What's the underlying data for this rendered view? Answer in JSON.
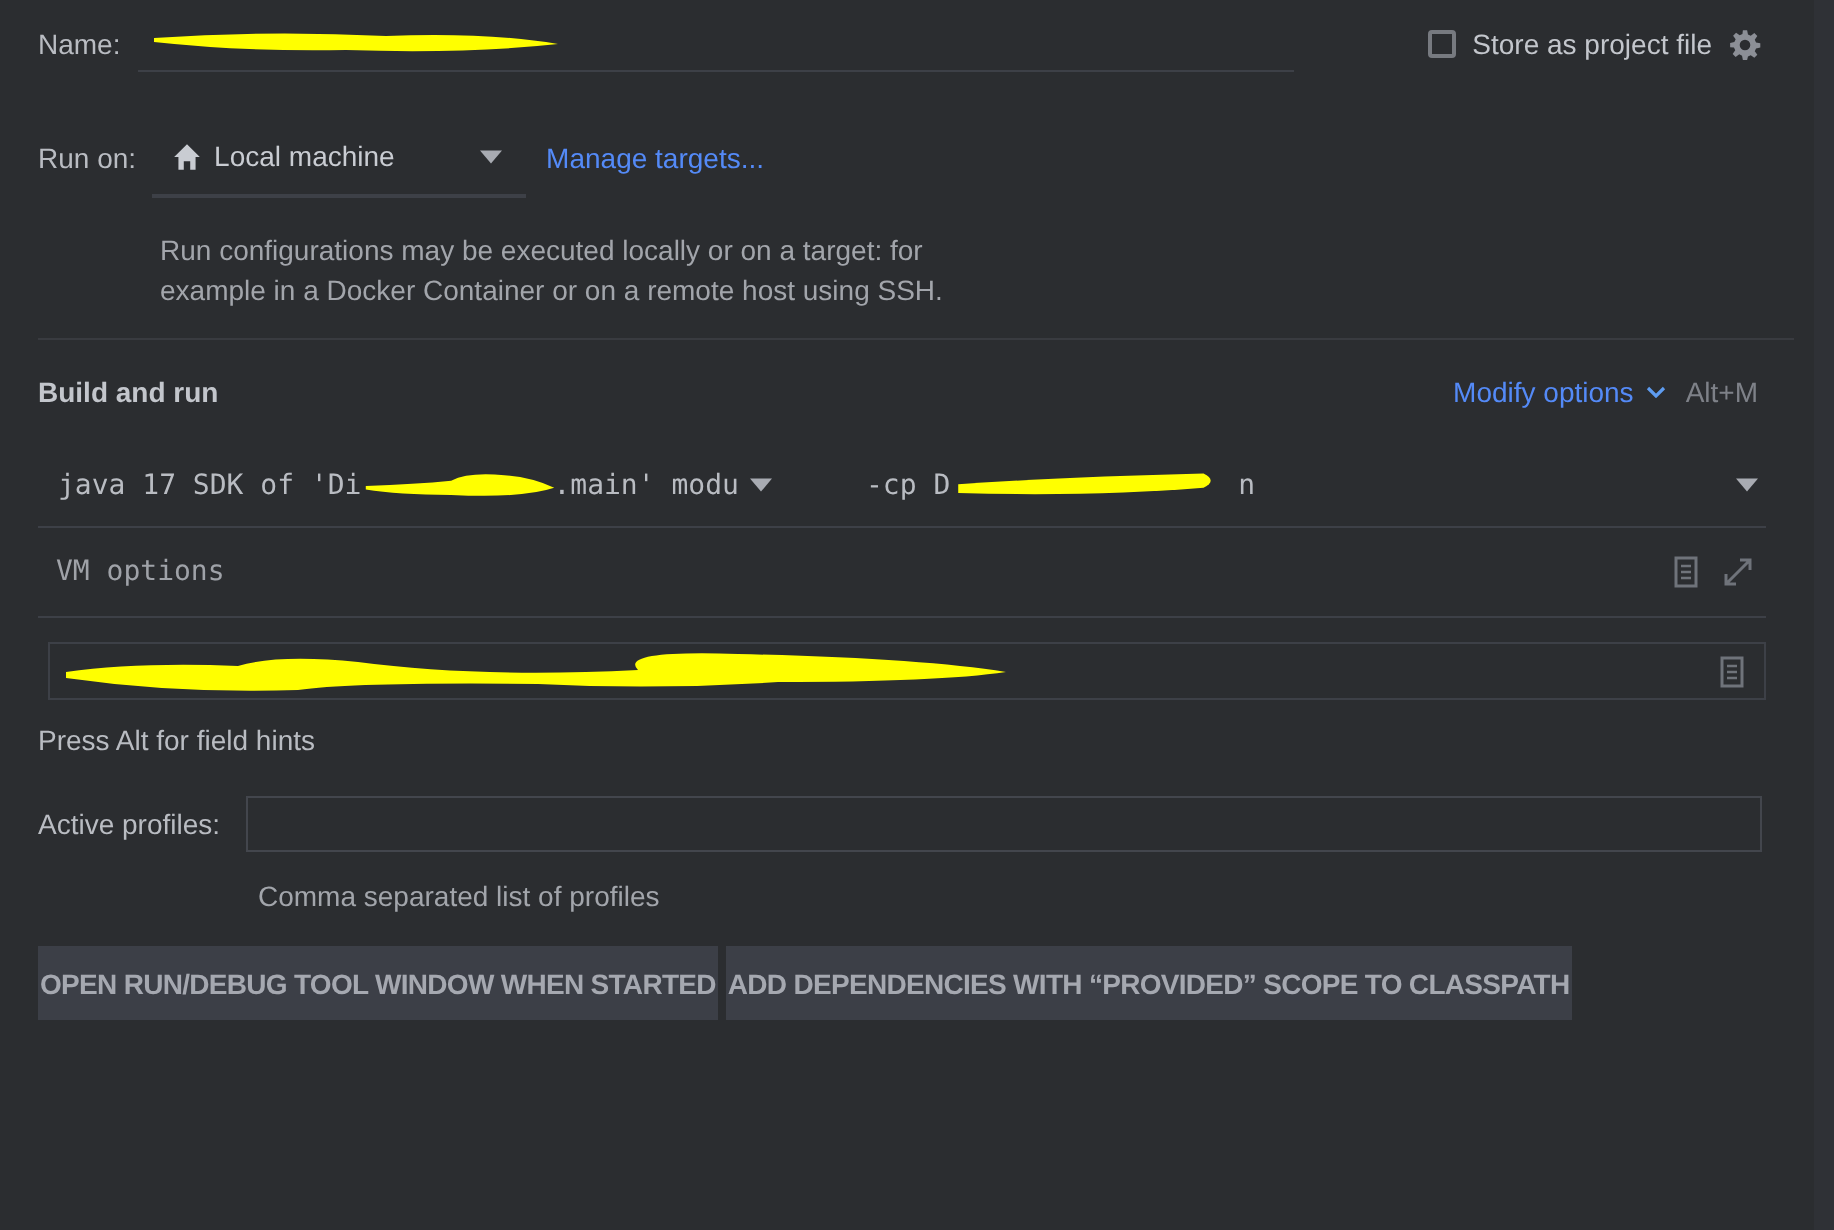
{
  "name_row": {
    "label": "Name:",
    "redacted": true,
    "store_checkbox": {
      "label": "Store as project file",
      "checked": false
    }
  },
  "run_on": {
    "label": "Run on:",
    "target": "Local machine",
    "link": "Manage targets...",
    "description": "Run configurations may be executed locally or on a target: for example in a Docker Container or on a remote host using SSH."
  },
  "build_and_run": {
    "title": "Build and run",
    "modify_link": "Modify options",
    "shortcut": "Alt+M",
    "jre": {
      "prefix": "java 17 SDK of 'Di",
      "suffix": ".main' modu",
      "redacted": true
    },
    "classpath": {
      "prefix": "-cp D",
      "suffix": "n",
      "redacted": true
    },
    "vm_options": {
      "placeholder": "VM options"
    },
    "program_arguments": {
      "redacted": true
    }
  },
  "field_hint": "Press Alt for field hints",
  "active_profiles": {
    "label": "Active profiles:",
    "hint": "Comma separated list of profiles"
  },
  "option_tags": [
    "OPEN RUN/DEBUG TOOL WINDOW WHEN STARTED",
    "ADD DEPENDENCIES WITH “PROVIDED” SCOPE TO CLASSPATH"
  ]
}
